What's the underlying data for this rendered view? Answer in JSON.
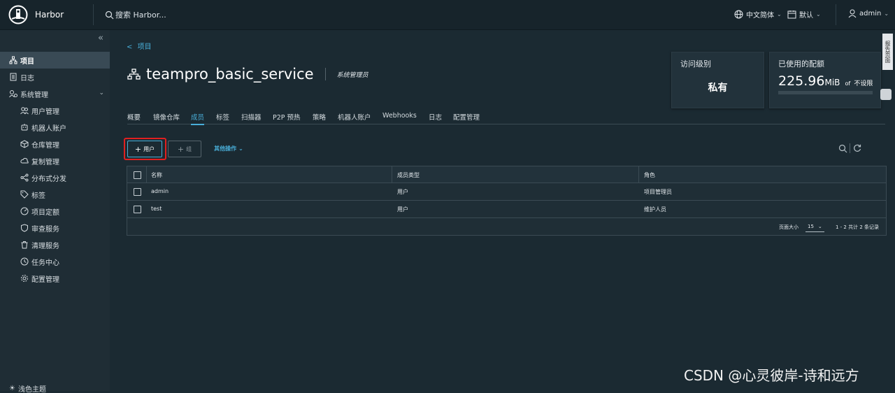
{
  "header": {
    "app_name": "Harbor",
    "search_placeholder": "搜索 Harbor...",
    "language": "中文简体",
    "theme": "默认",
    "user": "admin"
  },
  "sidebar": {
    "items": [
      {
        "label": "项目",
        "icon": "projects-icon"
      },
      {
        "label": "日志",
        "icon": "logs-icon"
      },
      {
        "label": "系统管理",
        "icon": "admin-icon"
      }
    ],
    "sub_items": [
      {
        "label": "用户管理",
        "icon": "users-icon"
      },
      {
        "label": "机器人账户",
        "icon": "robot-icon"
      },
      {
        "label": "仓库管理",
        "icon": "registry-icon"
      },
      {
        "label": "复制管理",
        "icon": "replication-icon"
      },
      {
        "label": "分布式分发",
        "icon": "distribution-icon"
      },
      {
        "label": "标签",
        "icon": "tag-icon"
      },
      {
        "label": "项目定额",
        "icon": "quota-icon"
      },
      {
        "label": "审查服务",
        "icon": "shield-icon"
      },
      {
        "label": "清理服务",
        "icon": "trash-icon"
      },
      {
        "label": "任务中心",
        "icon": "clock-icon"
      },
      {
        "label": "配置管理",
        "icon": "gear-icon"
      }
    ],
    "bottom_item": "浅色主题"
  },
  "breadcrumb": "项目",
  "project": {
    "name": "teampro_basic_service",
    "role": "系统管理员"
  },
  "cards": {
    "access": {
      "label": "访问级别",
      "value": "私有"
    },
    "quota": {
      "label": "已使用的配额",
      "used": "225.96",
      "unit": "MiB",
      "of": "of",
      "limit": "不设限"
    }
  },
  "tabs": [
    "概要",
    "镜像仓库",
    "成员",
    "标签",
    "扫描器",
    "P2P 预热",
    "策略",
    "机器人账户",
    "Webhooks",
    "日志",
    "配置管理"
  ],
  "active_tab": "成员",
  "toolbar": {
    "add_user": "用户",
    "add_group": "组",
    "more_actions": "其他操作"
  },
  "table": {
    "columns": [
      "名称",
      "成员类型",
      "角色"
    ],
    "rows": [
      {
        "name": "admin",
        "type": "用户",
        "role": "项目管理员"
      },
      {
        "name": "test",
        "type": "用户",
        "role": "维护人员"
      }
    ],
    "page_size_label": "页面大小",
    "page_size": "15",
    "summary": "1 - 2 共计 2 条记录"
  },
  "side_tab": "报告页面",
  "watermark": "CSDN @心灵彼岸-诗和远方",
  "colors": {
    "accent": "#49afd9",
    "highlight": "#e02020",
    "background": "#1b2a32"
  }
}
